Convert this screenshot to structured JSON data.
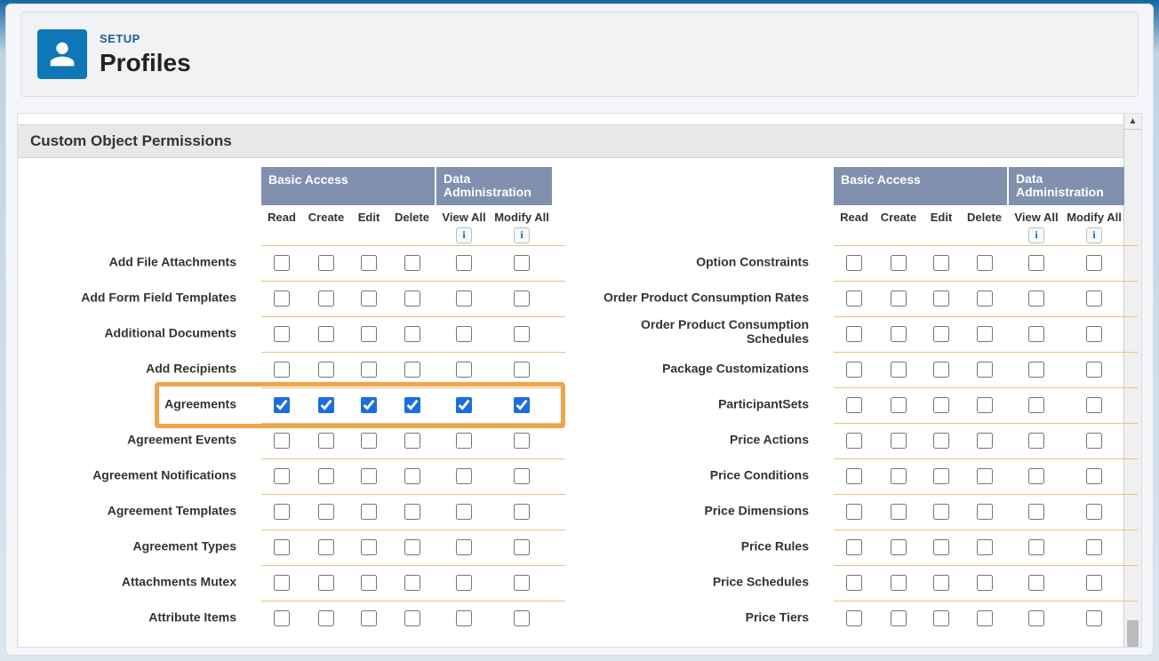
{
  "header": {
    "setup_label": "SETUP",
    "title": "Profiles"
  },
  "section": {
    "title": "Custom Object Permissions"
  },
  "column_groups": {
    "basic": "Basic Access",
    "data": "Data Administration"
  },
  "columns": {
    "read": "Read",
    "create": "Create",
    "edit": "Edit",
    "delete": "Delete",
    "view_all": "View All",
    "modify_all": "Modify All"
  },
  "left_rows": [
    {
      "label": "Add File Attachments",
      "read": false,
      "create": false,
      "edit": false,
      "delete": false,
      "view_all": false,
      "modify_all": false,
      "highlight": false
    },
    {
      "label": "Add Form Field Templates",
      "read": false,
      "create": false,
      "edit": false,
      "delete": false,
      "view_all": false,
      "modify_all": false,
      "highlight": false
    },
    {
      "label": "Additional Documents",
      "read": false,
      "create": false,
      "edit": false,
      "delete": false,
      "view_all": false,
      "modify_all": false,
      "highlight": false
    },
    {
      "label": "Add Recipients",
      "read": false,
      "create": false,
      "edit": false,
      "delete": false,
      "view_all": false,
      "modify_all": false,
      "highlight": false
    },
    {
      "label": "Agreements",
      "read": true,
      "create": true,
      "edit": true,
      "delete": true,
      "view_all": true,
      "modify_all": true,
      "highlight": true
    },
    {
      "label": "Agreement Events",
      "read": false,
      "create": false,
      "edit": false,
      "delete": false,
      "view_all": false,
      "modify_all": false,
      "highlight": false
    },
    {
      "label": "Agreement Notifications",
      "read": false,
      "create": false,
      "edit": false,
      "delete": false,
      "view_all": false,
      "modify_all": false,
      "highlight": false
    },
    {
      "label": "Agreement Templates",
      "read": false,
      "create": false,
      "edit": false,
      "delete": false,
      "view_all": false,
      "modify_all": false,
      "highlight": false
    },
    {
      "label": "Agreement Types",
      "read": false,
      "create": false,
      "edit": false,
      "delete": false,
      "view_all": false,
      "modify_all": false,
      "highlight": false
    },
    {
      "label": "Attachments Mutex",
      "read": false,
      "create": false,
      "edit": false,
      "delete": false,
      "view_all": false,
      "modify_all": false,
      "highlight": false
    },
    {
      "label": "Attribute Items",
      "read": false,
      "create": false,
      "edit": false,
      "delete": false,
      "view_all": false,
      "modify_all": false,
      "highlight": false
    }
  ],
  "right_rows": [
    {
      "label": "Option Constraints",
      "read": false,
      "create": false,
      "edit": false,
      "delete": false,
      "view_all": false,
      "modify_all": false
    },
    {
      "label": "Order Product Consumption Rates",
      "read": false,
      "create": false,
      "edit": false,
      "delete": false,
      "view_all": false,
      "modify_all": false
    },
    {
      "label": "Order Product Consumption Schedules",
      "read": false,
      "create": false,
      "edit": false,
      "delete": false,
      "view_all": false,
      "modify_all": false
    },
    {
      "label": "Package Customizations",
      "read": false,
      "create": false,
      "edit": false,
      "delete": false,
      "view_all": false,
      "modify_all": false
    },
    {
      "label": "ParticipantSets",
      "read": false,
      "create": false,
      "edit": false,
      "delete": false,
      "view_all": false,
      "modify_all": false
    },
    {
      "label": "Price Actions",
      "read": false,
      "create": false,
      "edit": false,
      "delete": false,
      "view_all": false,
      "modify_all": false
    },
    {
      "label": "Price Conditions",
      "read": false,
      "create": false,
      "edit": false,
      "delete": false,
      "view_all": false,
      "modify_all": false
    },
    {
      "label": "Price Dimensions",
      "read": false,
      "create": false,
      "edit": false,
      "delete": false,
      "view_all": false,
      "modify_all": false
    },
    {
      "label": "Price Rules",
      "read": false,
      "create": false,
      "edit": false,
      "delete": false,
      "view_all": false,
      "modify_all": false
    },
    {
      "label": "Price Schedules",
      "read": false,
      "create": false,
      "edit": false,
      "delete": false,
      "view_all": false,
      "modify_all": false
    },
    {
      "label": "Price Tiers",
      "read": false,
      "create": false,
      "edit": false,
      "delete": false,
      "view_all": false,
      "modify_all": false
    }
  ]
}
